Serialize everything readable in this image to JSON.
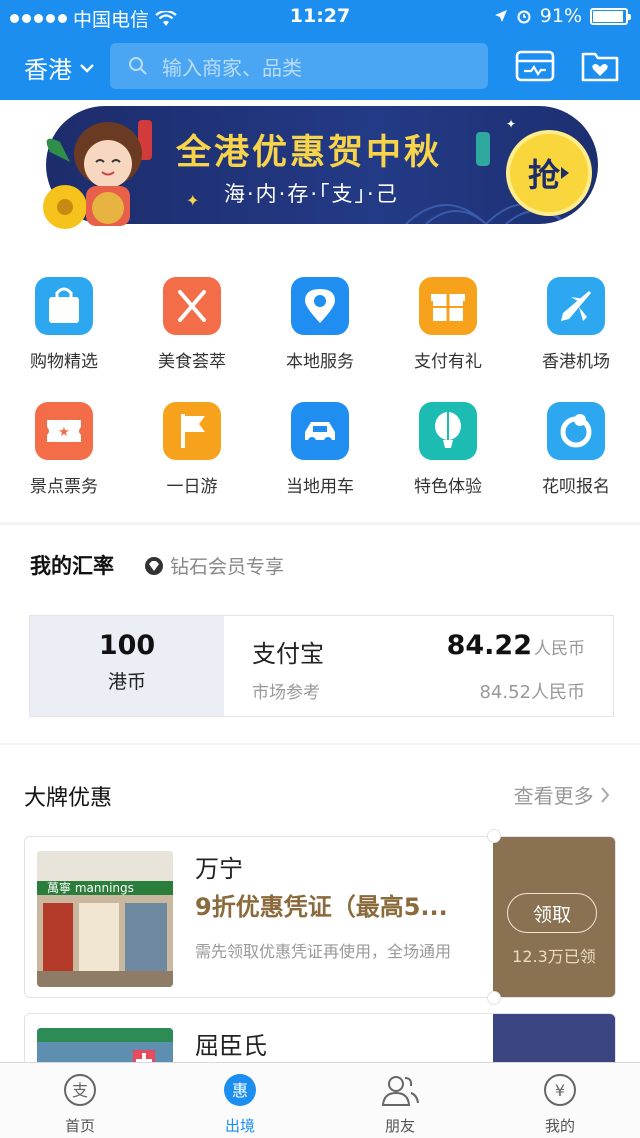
{
  "status_bar": {
    "carrier": "中国电信",
    "time": "11:27",
    "battery": "91%"
  },
  "header": {
    "city": "香港",
    "search_placeholder": "输入商家、品类"
  },
  "banner": {
    "title": "全港优惠贺中秋",
    "subtitle": "海·内·存·「支」·己",
    "badge": "抢"
  },
  "categories": [
    {
      "label": "购物精选",
      "icon": "shopping-bag-icon",
      "color": "#2da7f0"
    },
    {
      "label": "美食荟萃",
      "icon": "fork-knife-icon",
      "color": "#f36e48"
    },
    {
      "label": "本地服务",
      "icon": "location-pin-icon",
      "color": "#1f8ef0"
    },
    {
      "label": "支付有礼",
      "icon": "gift-icon",
      "color": "#f7a21c"
    },
    {
      "label": "香港机场",
      "icon": "airplane-icon",
      "color": "#2da7f0"
    },
    {
      "label": "景点票务",
      "icon": "ticket-icon",
      "color": "#f36e48"
    },
    {
      "label": "一日游",
      "icon": "flag-icon",
      "color": "#f7a21c"
    },
    {
      "label": "当地用车",
      "icon": "car-icon",
      "color": "#1f8ef0"
    },
    {
      "label": "特色体验",
      "icon": "balloon-icon",
      "color": "#1cbcb3"
    },
    {
      "label": "花呗报名",
      "icon": "huabei-icon",
      "color": "#2da7f0"
    }
  ],
  "exchange": {
    "title": "我的汇率",
    "member_tag": "钻石会员专享",
    "amount": "100",
    "currency": "港币",
    "provider": "支付宝",
    "market_label": "市场参考",
    "rate": "84.22",
    "rate_unit": "人民币",
    "market_rate": "84.52人民币"
  },
  "brand_deals": {
    "title": "大牌优惠",
    "more": "查看更多",
    "coupons": [
      {
        "name": "万宁",
        "offer": "9折优惠凭证（最高5...",
        "desc": "需先领取优惠凭证再使用，全场通用",
        "button": "领取",
        "claimed": "12.3万已领",
        "stub_color": "#8a7152"
      },
      {
        "name": "屈臣氏",
        "stub_color": "#3a4582"
      }
    ]
  },
  "tabbar": [
    {
      "label": "首页",
      "icon": "home-alipay-icon"
    },
    {
      "label": "出境",
      "icon": "discount-icon"
    },
    {
      "label": "朋友",
      "icon": "friends-icon"
    },
    {
      "label": "我的",
      "icon": "yuan-icon"
    }
  ],
  "colors": {
    "brand_blue": "#1b8ef0",
    "offer_brown": "#8b6a3b"
  }
}
